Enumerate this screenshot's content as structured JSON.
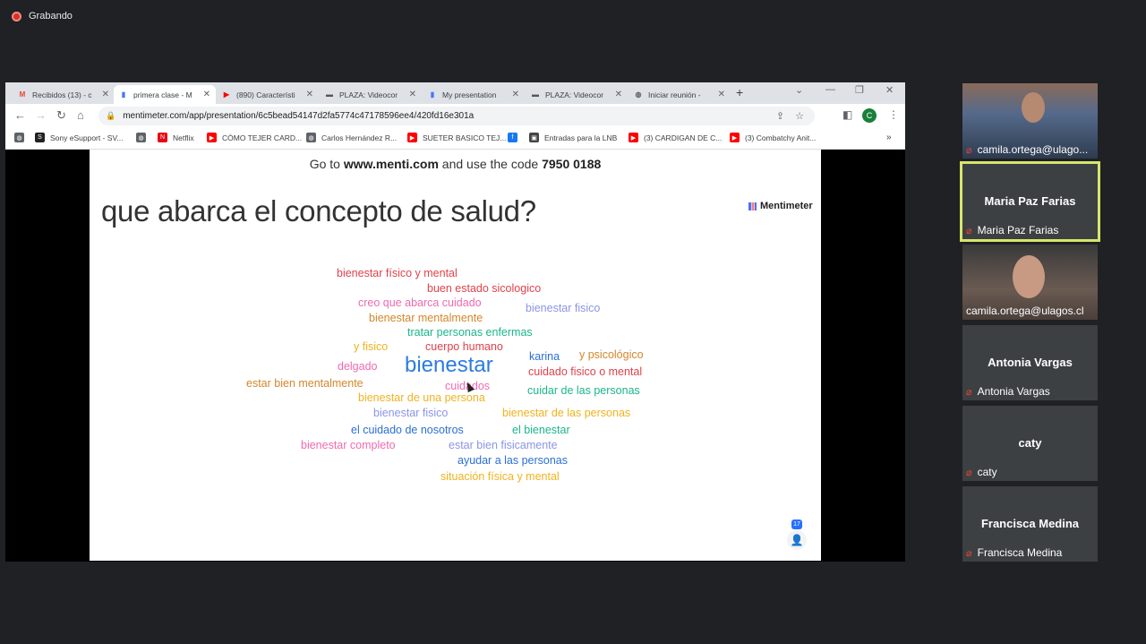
{
  "recording": {
    "label": "Grabando"
  },
  "browser": {
    "tabs": [
      {
        "title": "Recibidos (13) - c",
        "favicon": "gmail-icon",
        "color": "#ea4335"
      },
      {
        "title": "primera clase - M",
        "favicon": "mentimeter-icon",
        "color": "#4a72ff",
        "active": true
      },
      {
        "title": "(890) Característi",
        "favicon": "youtube-icon",
        "color": "#ff0000"
      },
      {
        "title": "PLAZA: Videocor",
        "favicon": "plaza-icon",
        "color": "#555555"
      },
      {
        "title": "My presentation",
        "favicon": "mentimeter-icon",
        "color": "#4a72ff"
      },
      {
        "title": "PLAZA: Videocor",
        "favicon": "plaza-icon",
        "color": "#555555"
      },
      {
        "title": "Iniciar reunión -",
        "favicon": "globe-icon",
        "color": "#5f6368"
      }
    ],
    "url": "mentimeter.com/app/presentation/6c5bead54147d2fa5774c47178596ee4/420fd16e301a",
    "profile_initial": "C",
    "bookmarks": [
      {
        "label": "",
        "icon": "globe-icon",
        "color": "#5f6368"
      },
      {
        "label": "Sony eSupport - SV...",
        "icon": "sony-icon",
        "color": "#222222"
      },
      {
        "label": "",
        "icon": "globe-icon",
        "color": "#5f6368"
      },
      {
        "label": "Netflix",
        "icon": "netflix-icon",
        "color": "#e50914"
      },
      {
        "label": "CÓMO TEJER CARD...",
        "icon": "youtube-icon",
        "color": "#ff0000"
      },
      {
        "label": "Carlos Hernández R...",
        "icon": "globe-icon",
        "color": "#5f6368"
      },
      {
        "label": "SUETER BASICO TEJ...",
        "icon": "youtube-icon",
        "color": "#ff0000"
      },
      {
        "label": "",
        "icon": "facebook-icon",
        "color": "#1877f2"
      },
      {
        "label": "Entradas para la LNB",
        "icon": "ticket-icon",
        "color": "#444444"
      },
      {
        "label": "(3) CARDIGAN DE C...",
        "icon": "youtube-icon",
        "color": "#ff0000"
      },
      {
        "label": "(3) Combatchy Anit...",
        "icon": "youtube-icon",
        "color": "#ff0000"
      }
    ]
  },
  "slide": {
    "instruction_prefix": "Go to ",
    "instruction_site": "www.menti.com",
    "instruction_mid": " and use the code ",
    "instruction_code": "7950 0188",
    "brand": "Mentimeter",
    "question": "que abarca el concepto de salud?",
    "response_count": "17",
    "words": [
      {
        "text": "bienestar físico y mental",
        "color": "#e0424a"
      },
      {
        "text": "buen estado sicologico",
        "color": "#e0424a"
      },
      {
        "text": "creo que abarca cuidado",
        "color": "#f06ab0"
      },
      {
        "text": "bienestar fisico",
        "color": "#8d94e8"
      },
      {
        "text": "bienestar mentalmente",
        "color": "#d4862a"
      },
      {
        "text": "tratar personas enfermas",
        "color": "#1cb58b"
      },
      {
        "text": "y fisico",
        "color": "#f0b31f"
      },
      {
        "text": "cuerpo humano",
        "color": "#e0424a"
      },
      {
        "text": "karina",
        "color": "#2b6fd6"
      },
      {
        "text": "y psicológico",
        "color": "#d4862a"
      },
      {
        "text": "delgado",
        "color": "#f06ab0"
      },
      {
        "text": "bienestar",
        "color": "#2b7be4"
      },
      {
        "text": "cuidado fisico o mental",
        "color": "#e0424a"
      },
      {
        "text": "estar bien mentalmente",
        "color": "#d4862a"
      },
      {
        "text": "cuidados",
        "color": "#f06ab0"
      },
      {
        "text": "cuidar de las personas",
        "color": "#1cb58b"
      },
      {
        "text": "bienestar de una persona",
        "color": "#f0b31f"
      },
      {
        "text": "bienestar fisico",
        "color": "#8d94e8"
      },
      {
        "text": "bienestar de las personas",
        "color": "#f0b31f"
      },
      {
        "text": "el cuidado de nosotros",
        "color": "#2b6fd6"
      },
      {
        "text": "el bienestar",
        "color": "#1cb58b"
      },
      {
        "text": "bienestar completo",
        "color": "#f06ab0"
      },
      {
        "text": "estar bien fisicamente",
        "color": "#8d94e8"
      },
      {
        "text": "ayudar a las personas",
        "color": "#2b6fd6"
      },
      {
        "text": "situación física y mental",
        "color": "#f0b31f"
      }
    ]
  },
  "participants": [
    {
      "label": "camila.ortega@ulago...",
      "video": true,
      "muted": true
    },
    {
      "name": "Maria Paz Farias",
      "label": "Maria Paz Farias",
      "muted": true,
      "speaking": true
    },
    {
      "label": "camila.ortega@ulagos.cl",
      "video": true,
      "muted": false
    },
    {
      "name": "Antonia Vargas",
      "label": "Antonia Vargas",
      "muted": true
    },
    {
      "name": "caty",
      "label": "caty",
      "muted": true
    },
    {
      "name": "Francisca Medina",
      "label": "Francisca Medina",
      "muted": true
    }
  ]
}
